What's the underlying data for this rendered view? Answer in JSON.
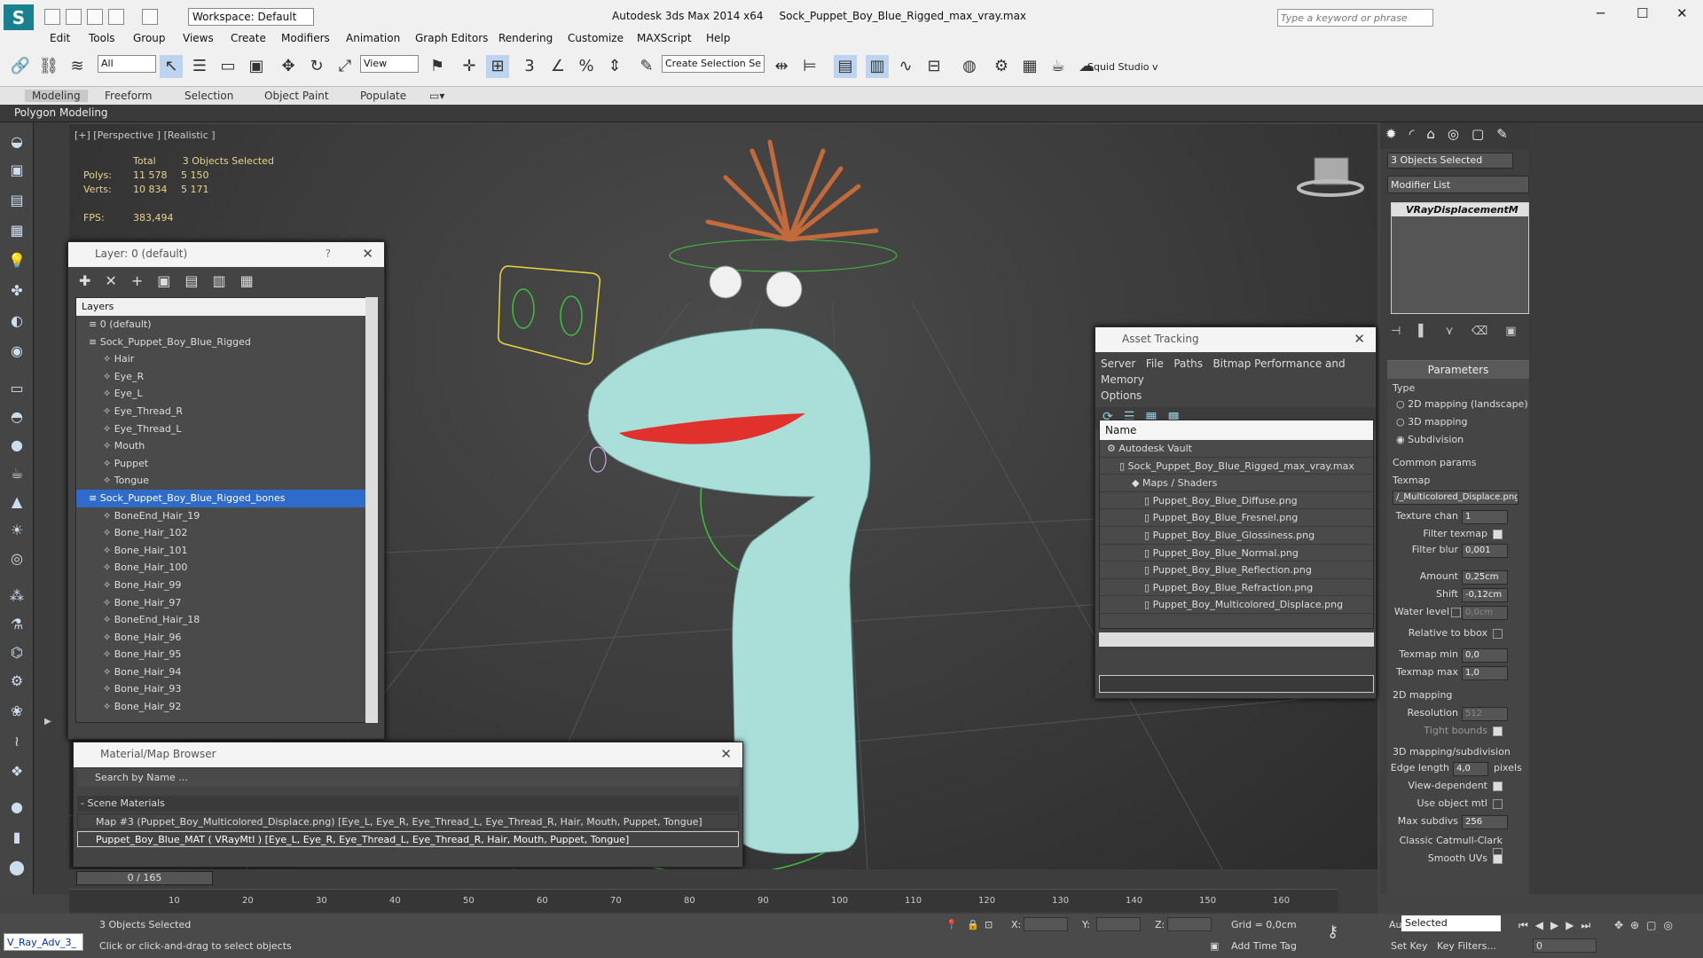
{
  "app": {
    "title": "Autodesk 3ds Max  2014 x64",
    "file": "Sock_Puppet_Boy_Blue_Rigged_max_vray.max",
    "workspace": "Workspace: Default",
    "search_placeholder": "Type a keyword or phrase"
  },
  "menu": [
    "Edit",
    "Tools",
    "Group",
    "Views",
    "Create",
    "Modifiers",
    "Animation",
    "Graph Editors",
    "Rendering",
    "Customize",
    "MAXScript",
    "Help"
  ],
  "toolbar": {
    "filter": "All",
    "view": "View",
    "selection_set": "Create Selection Se",
    "squid": "Squid Studio v"
  },
  "ribbon": {
    "tabs": [
      "Modeling",
      "Freeform",
      "Selection",
      "Object Paint",
      "Populate"
    ],
    "sub": "Polygon Modeling"
  },
  "viewport": {
    "label": "[+] [Perspective ] [Realistic ]",
    "stats": {
      "total_label": "Total",
      "selected_label": "3 Objects Selected",
      "polys_label": "Polys:",
      "polys_total": "11 578",
      "polys_sel": "5 150",
      "verts_label": "Verts:",
      "verts_total": "10 834",
      "verts_sel": "5 171",
      "fps_label": "FPS:",
      "fps": "383,494"
    }
  },
  "layer_dialog": {
    "title": "Layer: 0 (default)",
    "help": "?",
    "header": "Layers",
    "rows": [
      {
        "name": "0 (default)",
        "indent": 1
      },
      {
        "name": "Sock_Puppet_Boy_Blue_Rigged",
        "indent": 1
      },
      {
        "name": "Hair",
        "indent": 2
      },
      {
        "name": "Eye_R",
        "indent": 2
      },
      {
        "name": "Eye_L",
        "indent": 2
      },
      {
        "name": "Eye_Thread_R",
        "indent": 2
      },
      {
        "name": "Eye_Thread_L",
        "indent": 2
      },
      {
        "name": "Mouth",
        "indent": 2
      },
      {
        "name": "Puppet",
        "indent": 2
      },
      {
        "name": "Tongue",
        "indent": 2
      },
      {
        "name": "Sock_Puppet_Boy_Blue_Rigged_bones",
        "indent": 1,
        "selected": true
      },
      {
        "name": "BoneEnd_Hair_19",
        "indent": 2
      },
      {
        "name": "Bone_Hair_102",
        "indent": 2
      },
      {
        "name": "Bone_Hair_101",
        "indent": 2
      },
      {
        "name": "Bone_Hair_100",
        "indent": 2
      },
      {
        "name": "Bone_Hair_99",
        "indent": 2
      },
      {
        "name": "Bone_Hair_97",
        "indent": 2
      },
      {
        "name": "BoneEnd_Hair_18",
        "indent": 2
      },
      {
        "name": "Bone_Hair_96",
        "indent": 2
      },
      {
        "name": "Bone_Hair_95",
        "indent": 2
      },
      {
        "name": "Bone_Hair_94",
        "indent": 2
      },
      {
        "name": "Bone_Hair_93",
        "indent": 2
      },
      {
        "name": "Bone_Hair_92",
        "indent": 2
      }
    ]
  },
  "asset_tracking": {
    "title": "Asset Tracking",
    "menu": [
      "Server",
      "File",
      "Paths",
      "Bitmap Performance and Memory",
      "Options"
    ],
    "col_name": "Name",
    "rows": [
      {
        "name": "Autodesk Vault",
        "indent": 1
      },
      {
        "name": "Sock_Puppet_Boy_Blue_Rigged_max_vray.max",
        "indent": 2
      },
      {
        "name": "Maps / Shaders",
        "indent": 3
      },
      {
        "name": "Puppet_Boy_Blue_Diffuse.png",
        "indent": 4
      },
      {
        "name": "Puppet_Boy_Blue_Fresnel.png",
        "indent": 4
      },
      {
        "name": "Puppet_Boy_Blue_Glossiness.png",
        "indent": 4
      },
      {
        "name": "Puppet_Boy_Blue_Normal.png",
        "indent": 4
      },
      {
        "name": "Puppet_Boy_Blue_Reflection.png",
        "indent": 4
      },
      {
        "name": "Puppet_Boy_Blue_Refraction.png",
        "indent": 4
      },
      {
        "name": "Puppet_Boy_Multicolored_Displace.png",
        "indent": 4
      }
    ]
  },
  "material_browser": {
    "title": "Material/Map Browser",
    "search_placeholder": "Search by Name ...",
    "section": "- Scene Materials",
    "items": [
      "Map #3 (Puppet_Boy_Multicolored_Displace.png)  [Eye_L, Eye_R, Eye_Thread_L, Eye_Thread_R, Hair, Mouth, Puppet, Tongue]",
      "Puppet_Boy_Blue_MAT  ( VRayMtl )  [Eye_L, Eye_R, Eye_Thread_L, Eye_Thread_R, Hair, Mouth, Puppet, Tongue]"
    ]
  },
  "command_panel": {
    "selection": "3 Objects Selected",
    "modifier_list": "Modifier List",
    "modifier": "VRayDisplacementM",
    "params_title": "Parameters",
    "type_label": "Type",
    "types": [
      "2D mapping (landscape)",
      "3D mapping",
      "Subdivision"
    ],
    "common": "Common params",
    "texmap_label": "Texmap",
    "texmap": "/_Multicolored_Displace.png)",
    "texture_chan_label": "Texture chan",
    "texture_chan": "1",
    "filter_texmap": "Filter texmap",
    "filter_blur_label": "Filter blur",
    "filter_blur": "0,001",
    "amount_label": "Amount",
    "amount": "0,25cm",
    "shift_label": "Shift",
    "shift": "-0,12cm",
    "water_label": "Water level",
    "water": "0,0cm",
    "rel_bbox": "Relative to bbox",
    "texmin_label": "Texmap min",
    "texmin": "0,0",
    "texmax_label": "Texmap max",
    "texmax": "1,0",
    "mapping2d": "2D mapping",
    "resolution_label": "Resolution",
    "resolution": "512",
    "tight": "Tight bounds",
    "mapping3d": "3D mapping/subdivision",
    "edge_label": "Edge length",
    "edge": "4,0",
    "pixels": "pixels",
    "view_dep": "View-dependent",
    "use_obj": "Use object mtl",
    "max_subdiv_label": "Max subdivs",
    "max_subdiv": "256",
    "catmull": "Classic Catmull-Clark",
    "smooth": "Smooth UVs"
  },
  "timeline": {
    "frame": "0 / 165",
    "ticks": [
      "10",
      "20",
      "30",
      "40",
      "50",
      "60",
      "70",
      "80",
      "90",
      "100",
      "110",
      "120",
      "130",
      "140",
      "150",
      "160"
    ]
  },
  "status": {
    "maxscript": "V_Ray_Adv_3_",
    "selected": "3 Objects Selected",
    "prompt": "Click or click-and-drag to select objects",
    "x": "X:",
    "y": "Y:",
    "z": "Z:",
    "grid": "Grid = 0,0cm",
    "add_time_tag": "Add Time Tag",
    "auto_key": "Auto Key",
    "set_key": "Set Key",
    "key_mode": "Selected",
    "key_filters": "Key Filters...",
    "frame": "0"
  }
}
